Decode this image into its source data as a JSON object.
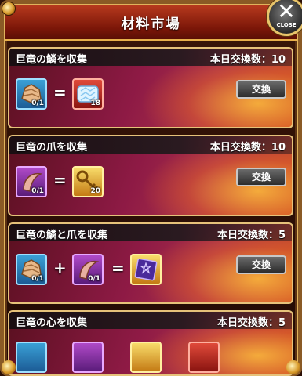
{
  "window": {
    "title": "材料市場",
    "close_label": "CLOSE",
    "close_glyph": "✕"
  },
  "cards": [
    {
      "name": "巨竜の鱗を収集",
      "count": "本日交換数：10",
      "button": "交換",
      "slots": [
        {
          "kind": "ingredient",
          "item": "dragon-scale",
          "frame": "blue",
          "qty": "0/1"
        },
        {
          "kind": "result",
          "item": "crystal-bundle",
          "frame": "red",
          "qty": "18"
        }
      ],
      "ops": [
        "="
      ]
    },
    {
      "name": "巨竜の爪を収集",
      "count": "本日交換数：10",
      "button": "交換",
      "slots": [
        {
          "kind": "ingredient",
          "item": "dragon-claw",
          "frame": "purple",
          "qty": "0/1"
        },
        {
          "kind": "result",
          "item": "gold-key",
          "frame": "gold",
          "qty": "20"
        }
      ],
      "ops": [
        "="
      ]
    },
    {
      "name": "巨竜の鱗と爪を収集",
      "count": "本日交換数：5",
      "button": "交換",
      "slots": [
        {
          "kind": "ingredient",
          "item": "dragon-scale",
          "frame": "blue",
          "qty": "0/1"
        },
        {
          "kind": "ingredient",
          "item": "dragon-claw",
          "frame": "purple",
          "qty": "0/1"
        },
        {
          "kind": "result",
          "item": "purple-tome",
          "frame": "gold",
          "qty": ""
        }
      ],
      "ops": [
        "+",
        "="
      ]
    },
    {
      "name": "巨竜の心を収集",
      "count": "本日交換数：5",
      "button": "交換",
      "slots": [],
      "ops": []
    }
  ],
  "colors": {
    "accent": "#e8b04a",
    "header": "#9a2812",
    "card": "#8e1a45"
  }
}
